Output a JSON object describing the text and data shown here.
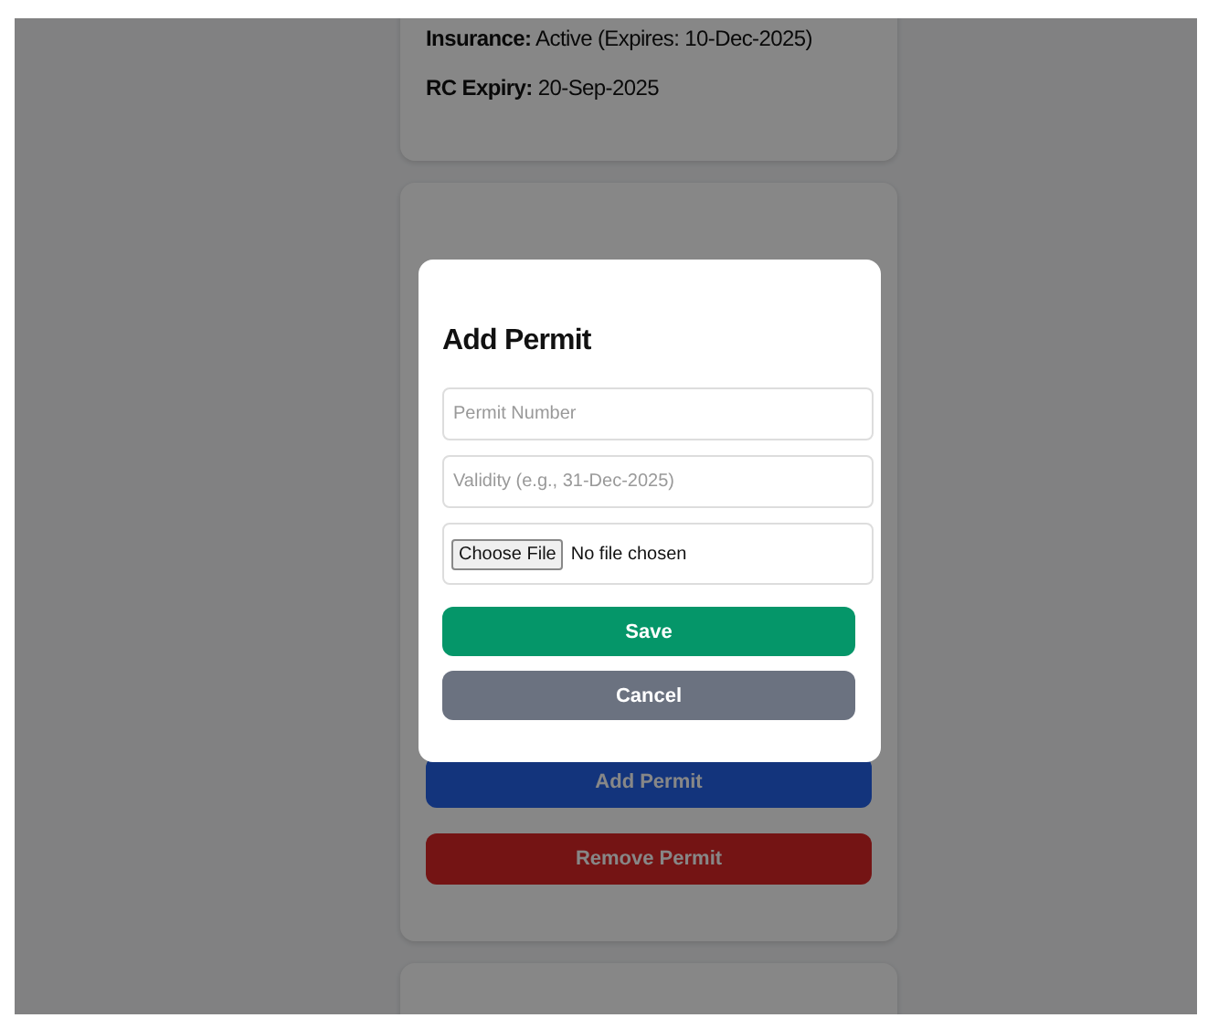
{
  "details_card": {
    "lines": [
      {
        "label": "Insurance:",
        "value": "Active (Expires: 10-Dec-2025)"
      },
      {
        "label": "RC Expiry:",
        "value": "20-Sep-2025"
      }
    ]
  },
  "permit_card": {
    "buttons": [
      {
        "label": "Add Permit",
        "kind": "primary"
      },
      {
        "label": "Remove Permit",
        "kind": "danger"
      }
    ]
  },
  "modal": {
    "title": "Add Permit",
    "fields": [
      {
        "placeholder": "Permit Number"
      },
      {
        "placeholder": "Validity (e.g., 31-Dec-2025)"
      }
    ],
    "file_input": {
      "button": "Choose File",
      "status": "No file chosen"
    },
    "buttons": [
      {
        "label": "Save",
        "kind": "success"
      },
      {
        "label": "Cancel",
        "kind": "secondary"
      }
    ]
  }
}
